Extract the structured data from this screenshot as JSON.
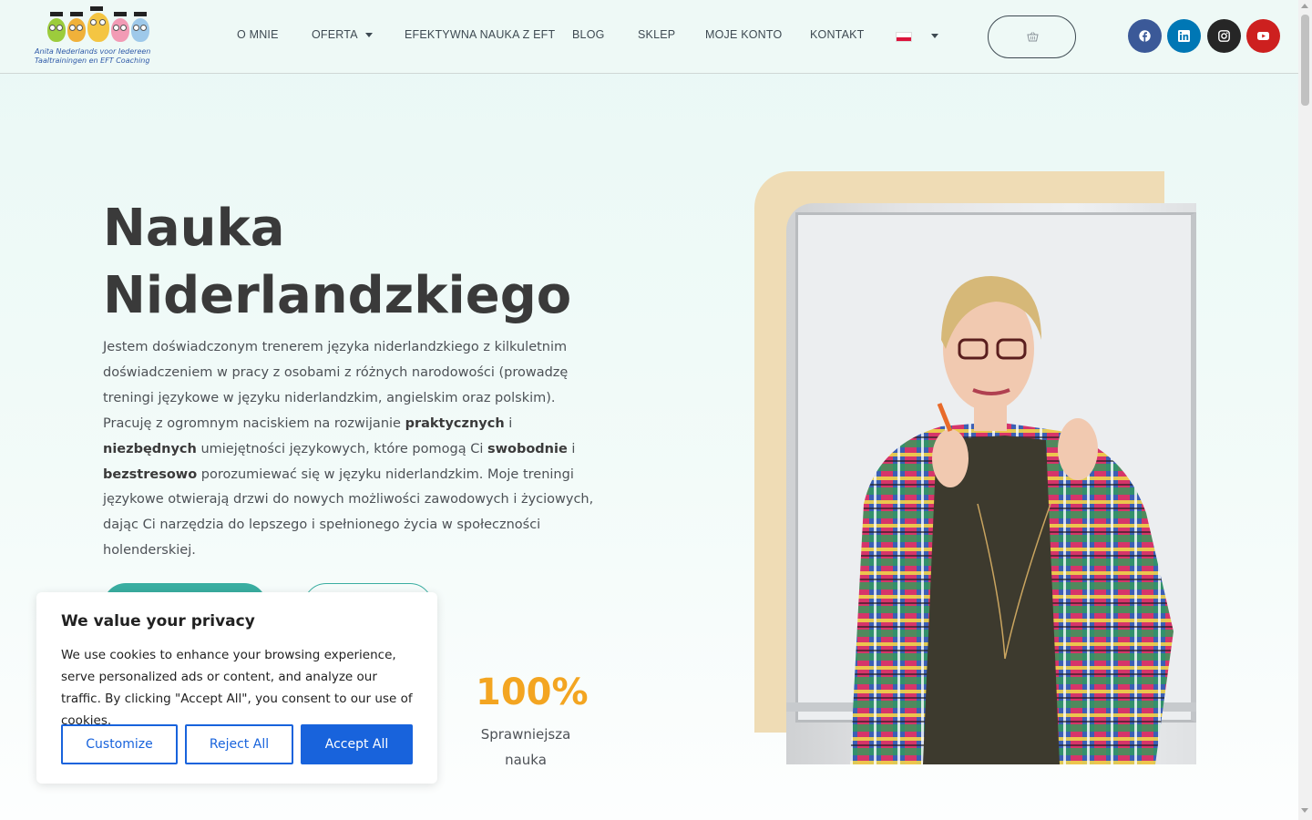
{
  "logo": {
    "line1": "Anita Nederlands voor Iedereen",
    "line2": "Taaltrainingen en EFT Coaching"
  },
  "nav": {
    "items": [
      "O MNIE",
      "OFERTA",
      "EFEKTYWNA NAUKA Z EFT",
      "BLOG",
      "SKLEP",
      "MOJE KONTO",
      "KONTAKT"
    ],
    "language": "pl-flag"
  },
  "cart": {
    "icon": "basket-icon"
  },
  "social": [
    {
      "name": "facebook-icon",
      "color": "#3b5998"
    },
    {
      "name": "linkedin-icon",
      "color": "#0077b5"
    },
    {
      "name": "instagram-icon",
      "color": "#262626"
    },
    {
      "name": "youtube-icon",
      "color": "#cd201f"
    }
  ],
  "hero": {
    "title_line1": "Nauka",
    "title_line2": "Niderlandzkiego",
    "text_a": "Jestem doświadczonym trenerem języka niderlandzkiego z kilkuletnim doświadczeniem w pracy z osobami z różnych narodowości (prowadzę treningi językowe w języku niderlandzkim, angielskim oraz polskim). Pracuję z ogromnym naciskiem na rozwijanie ",
    "bold_1": "praktycznych",
    "text_b": " i ",
    "bold_2": "niezbędnych",
    "text_c": " umiejętności językowych, które pomogą Ci ",
    "bold_3": "swobodnie",
    "text_d": " i ",
    "bold_4": "bezstresowo",
    "text_e": " porozumiewać się w języku niderlandzkim. Moje treningi językowe otwierają drzwi do nowych możliwości zawodowych i życiowych, dając Ci narzędzia do lepszego i spełnionego życia w społeczności holenderskiej."
  },
  "stat": {
    "value": "100%",
    "label": "Sprawniejsza nauka"
  },
  "cookie": {
    "title": "We value your privacy",
    "text": "We use cookies to enhance your browsing experience, serve personalized ads or content, and analyze our traffic. By clicking \"Accept All\", you consent to our use of cookies.",
    "customize": "Customize",
    "reject": "Reject All",
    "accept": "Accept All"
  },
  "colors": {
    "accent": "#3aaea1",
    "stat": "#f3a521",
    "cookie_primary": "#1863dc"
  }
}
